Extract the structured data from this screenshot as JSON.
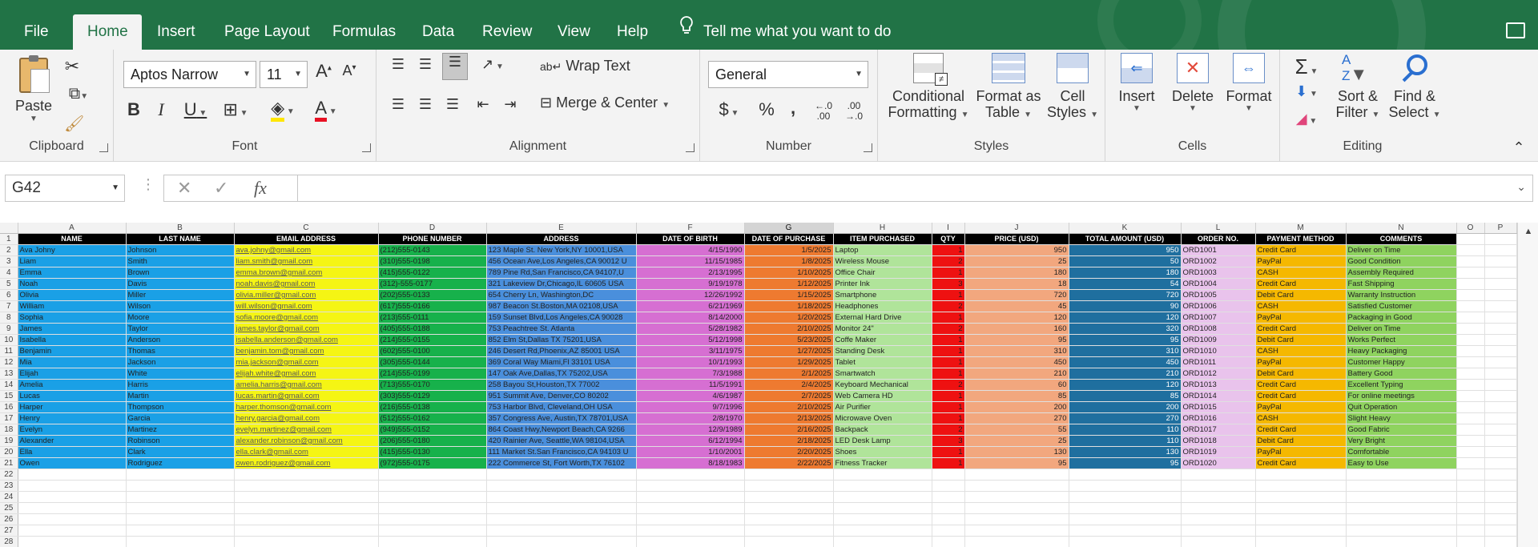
{
  "tabs": [
    {
      "label": "File"
    },
    {
      "label": "Home"
    },
    {
      "label": "Insert"
    },
    {
      "label": "Page Layout"
    },
    {
      "label": "Formulas"
    },
    {
      "label": "Data"
    },
    {
      "label": "Review"
    },
    {
      "label": "View"
    },
    {
      "label": "Help"
    }
  ],
  "tell_me": "Tell me what you want to do",
  "ribbon": {
    "clipboard": {
      "label": "Clipboard",
      "paste": "Paste"
    },
    "font": {
      "label": "Font",
      "name": "Aptos Narrow",
      "size": "11"
    },
    "alignment": {
      "label": "Alignment",
      "wrap": "Wrap Text",
      "merge": "Merge & Center"
    },
    "number": {
      "label": "Number",
      "format": "General"
    },
    "styles": {
      "label": "Styles",
      "cond1": "Conditional",
      "cond2": "Formatting",
      "fmt1": "Format as",
      "fmt2": "Table",
      "cell1": "Cell",
      "cell2": "Styles"
    },
    "cells": {
      "label": "Cells",
      "insert": "Insert",
      "delete": "Delete",
      "format": "Format"
    },
    "editing": {
      "label": "Editing",
      "sort1": "Sort &",
      "sort2": "Filter",
      "find1": "Find &",
      "find2": "Select"
    }
  },
  "formula_bar": {
    "name_box": "G42",
    "fx": "fx",
    "value": ""
  },
  "colors": {
    "excel_green": "#217346"
  },
  "sheet": {
    "column_letters": [
      "A",
      "B",
      "C",
      "D",
      "E",
      "F",
      "G",
      "H",
      "I",
      "J",
      "K",
      "L",
      "M",
      "N",
      "O",
      "P"
    ],
    "selected_column": "G",
    "headers": [
      "NAME",
      "LAST NAME",
      "EMAIL ADDRESS",
      "PHONE NUMBER",
      "ADDRESS",
      "DATE OF BIRTH",
      "DATE OF PURCHASE",
      "ITEM PURCHASED",
      "QTY",
      "PRICE (USD)",
      "TOTAL AMOUNT (USD)",
      "ORDER NO.",
      "PAYMENT METHOD",
      "COMMENTS"
    ],
    "column_colors": [
      "#1aa0e6",
      "#1aa0e6",
      "#f5f514",
      "#17b14b",
      "#4a8fdc",
      "#d66fd2",
      "#ee7a30",
      "#b0e49a",
      "#ee1111",
      "#f2a77e",
      "#1f6f9f",
      "#e9c3ec",
      "#f5b800",
      "#8fd35f"
    ],
    "rows": [
      [
        "Ava Johny",
        "Johnson",
        "ava.johny@gmail.com",
        "(212)555-0143",
        "123 Maple St. New York,NY 10001,USA",
        "4/15/1990",
        "1/5/2025",
        "Laptop",
        "1",
        "950",
        "950",
        "ORD1001",
        "Credit Card",
        "Deliver on Time"
      ],
      [
        "Liam",
        "Smith",
        "liam.smith@gmail.com",
        "(310)555-0198",
        "456 Ocean Ave,Los Angeles,CA 90012 U",
        "11/15/1985",
        "1/8/2025",
        "Wireless Mouse",
        "2",
        "25",
        "50",
        "ORD1002",
        "PayPal",
        "Good Condition"
      ],
      [
        "Emma",
        "Brown",
        "emma.brown@gmail.com",
        "(415)555-0122",
        "789 Pine Rd,San Francisco,CA 94107,U",
        "2/13/1995",
        "1/10/2025",
        "Office Chair",
        "1",
        "180",
        "180",
        "ORD1003",
        "CASH",
        "Assembly Required"
      ],
      [
        " Noah",
        "Davis",
        "noah.davis@gmail.com",
        "(312)-555-0177",
        "321 Lakeview Dr,Chicago,IL 60605 USA",
        "9/19/1978",
        "1/12/2025",
        "Printer Ink",
        "3",
        "18",
        "54",
        "ORD1004",
        "Credit Card",
        "Fast Shipping"
      ],
      [
        "Olivia",
        "Miller",
        "olivia.miller@gmail.com",
        "(202)555-0133",
        "654 Cherry Ln, Washington,DC",
        "12/26/1992",
        "1/15/2025",
        "Smartphone",
        "1",
        "720",
        "720",
        "ORD1005",
        "Debit Card",
        "Warranty Instruction"
      ],
      [
        "William",
        "Wilson",
        "will.wilson@gmail.com",
        "(617)555-0166",
        "987 Beacon St.Boston,MA 02108,USA",
        "6/21/1969",
        "1/18/2025",
        "Headphones",
        "2",
        "45",
        "90",
        "ORD1006",
        "CASH",
        "Satisfied Customer"
      ],
      [
        "Sophia",
        "Moore",
        "sofia.moore@gmail.com",
        "(213)555-0111",
        "159 Sunset Blvd,Los Angeles,CA 90028",
        "8/14/2000",
        "1/20/2025",
        "External Hard Drive",
        "1",
        "120",
        "120",
        "ORD1007",
        "PayPal",
        "Packaging in Good"
      ],
      [
        "James",
        "Taylor",
        "james.taylor@gmail.com",
        "(405)555-0188",
        "753 Peachtree St. Atlanta",
        "5/28/1982",
        "2/10/2025",
        "Monitor 24\"",
        "2",
        "160",
        "320",
        "ORD1008",
        "Credit Card",
        "Deliver on Time"
      ],
      [
        "Isabella",
        "Anderson",
        "isabella.anderson@gmail.com",
        "(214)555-0155",
        "852 Elm St,Dallas TX 75201,USA",
        "5/12/1998",
        "5/23/2025",
        "Coffe Maker",
        "1",
        "95",
        "95",
        "ORD1009",
        "Debit Card",
        "Works Perfect"
      ],
      [
        "Benjamin",
        "Thomas",
        "benjamin.tom@gmail.com",
        "(602)555-0100",
        "246 Desert Rd,Phoenix,AZ 85001 USA",
        "3/11/1975",
        "1/27/2025",
        "Standing Desk",
        "1",
        "310",
        "310",
        "ORD1010",
        "CASH",
        "Heavy Packaging"
      ],
      [
        "Mia",
        "Jackson",
        "mia.jackson@gmail.com",
        "(305)555-0144",
        "369 Coral Way Miami,Fl 33101 USA",
        "10/1/1993",
        "1/29/2025",
        "Tablet",
        "1",
        "450",
        "450",
        "ORD1011",
        "PayPal",
        "Customer Happy"
      ],
      [
        "Elijah",
        "White",
        "elijah.white@gmail.com",
        "(214)555-0199",
        "147 Oak Ave,Dallas,TX 75202,USA",
        "7/3/1988",
        "2/1/2025",
        "Smartwatch",
        "1",
        "210",
        "210",
        "ORD1012",
        "Debit Card",
        "Battery Good"
      ],
      [
        " Amelia",
        "Harris",
        "amelia.harris@gmail.com",
        "(713)555-0170",
        "258 Bayou St,Houston,TX 77002",
        "11/5/1991",
        "2/4/2025",
        "Keyboard Mechanical",
        "2",
        "60",
        "120",
        "ORD1013",
        "Credit Card",
        "Excellent Typing"
      ],
      [
        "Lucas",
        "Martin",
        "lucas.martin@gmail.com",
        "(303)555-0129",
        "951 Summit Ave, Denver,CO 80202",
        "4/6/1987",
        "2/7/2025",
        "Web Camera HD",
        "1",
        "85",
        "85",
        "ORD1014",
        "Credit Card",
        "For online meetings"
      ],
      [
        "Harper",
        "Thompson",
        "harper.thomson@gmail.com",
        "(216)555-0138",
        "753 Harbor Blvd, Cleveland,OH USA",
        "9/7/1996",
        "2/10/2025",
        "Air Purifier",
        "1",
        "200",
        "200",
        "ORD1015",
        "PayPal",
        "Quit Operation"
      ],
      [
        "Henry",
        "Garcia",
        "henry.garcia@gmail.com",
        "(512)555-0162",
        "357 Congress Ave, Austin,TX 78701,USA",
        "2/8/1970",
        "2/13/2025",
        "Microwave Oven",
        "1",
        "270",
        "270",
        "ORD1016",
        "CASH",
        "Slight Heavy"
      ],
      [
        "Evelyn",
        "Martinez",
        "evelyn.martinez@gmail.com",
        "(949)555-0152",
        "864 Coast Hwy,Newport Beach,CA 9266",
        "12/9/1989",
        "2/16/2025",
        "Backpack",
        "2",
        "55",
        "110",
        "ORD1017",
        "Credit Card",
        "Good Fabric"
      ],
      [
        "Alexander",
        "Robinson",
        "alexander.robinson@gmail.com",
        "(206)555-0180",
        "420 Rainier Ave, Seattle,WA 98104,USA",
        "6/12/1994",
        "2/18/2025",
        "LED Desk Lamp",
        "3",
        "25",
        "110",
        "ORD1018",
        "Debit Card",
        "Very Bright"
      ],
      [
        "Ella",
        "Clark",
        "ella.clark@gmail.com",
        "(415)555-0130",
        "111 Market St.San Francisco,CA 94103 U",
        "1/10/2001",
        "2/20/2025",
        "Shoes",
        "1",
        "130",
        "130",
        "ORD1019",
        "PayPal",
        "Comfortable"
      ],
      [
        "Owen",
        "Rodriguez",
        "owen.rodriguez@gmail.com",
        "(972)555-0175",
        "222 Commerce St, Fort Worth,TX 76102",
        "8/18/1983",
        "2/22/2025",
        "Fitness Tracker",
        "1",
        "95",
        "95",
        "ORD1020",
        "Credit Card",
        "Easy to Use"
      ]
    ],
    "empty_rows": [
      22,
      23,
      24,
      25,
      26,
      27,
      28
    ]
  }
}
